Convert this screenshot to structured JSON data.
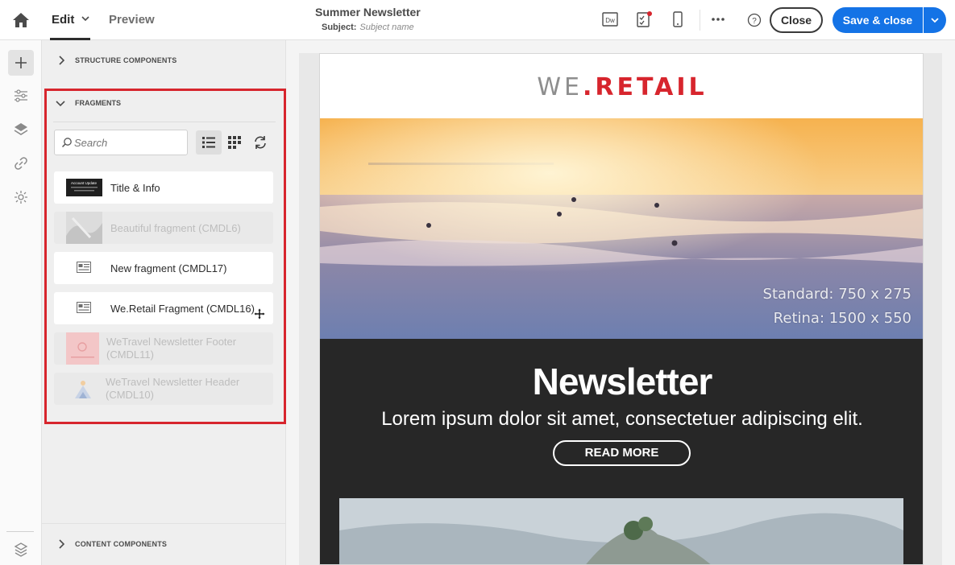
{
  "header": {
    "tabs": {
      "edit": "Edit",
      "preview": "Preview"
    },
    "title": "Summer Newsletter",
    "subject_label": "Subject:",
    "subject_value": "Subject name",
    "close_label": "Close",
    "save_label": "Save & close",
    "dw_label": "Dw"
  },
  "panel": {
    "structure_label": "STRUCTURE COMPONENTS",
    "fragments_label": "FRAGMENTS",
    "content_label": "CONTENT COMPONENTS",
    "search_placeholder": "Search",
    "title_info_thumb_text": "Account Update",
    "fragments": [
      {
        "name": "Title & Info",
        "enabled": true
      },
      {
        "name": "Beautiful fragment (CMDL6)",
        "enabled": false
      },
      {
        "name": "New fragment (CMDL17)",
        "enabled": true
      },
      {
        "name": "We.Retail Fragment (CMDL16)",
        "enabled": true
      },
      {
        "name": "WeTravel Newsletter Footer (CMDL11)",
        "enabled": false
      },
      {
        "name": "WeTravel Newsletter Header (CMDL10)",
        "enabled": false
      }
    ]
  },
  "email": {
    "logo_we": "WE",
    "logo_dot": ".",
    "logo_retail": "RETAIL",
    "hero_caption_1": "Standard: 750 x 275",
    "hero_caption_2": "Retina: 1500 x 550",
    "title": "Newsletter",
    "subtitle": "Lorem ipsum dolor sit amet, consectetuer adipiscing elit.",
    "cta": "READ MORE"
  },
  "colors": {
    "accent": "#1473e6",
    "highlight": "#d7252d",
    "dark_block": "#272727"
  },
  "icons": [
    "home-icon",
    "chevron-down-icon",
    "dreamweaver-icon",
    "checklist-icon",
    "mobile-icon",
    "more-icon",
    "help-icon",
    "plus-icon",
    "sliders-icon",
    "layers-icon",
    "link-icon",
    "personalization-icon",
    "settings-icon",
    "search-icon",
    "list-view-icon",
    "grid-view-icon",
    "refresh-icon",
    "fragment-icon",
    "move-cursor-icon"
  ]
}
